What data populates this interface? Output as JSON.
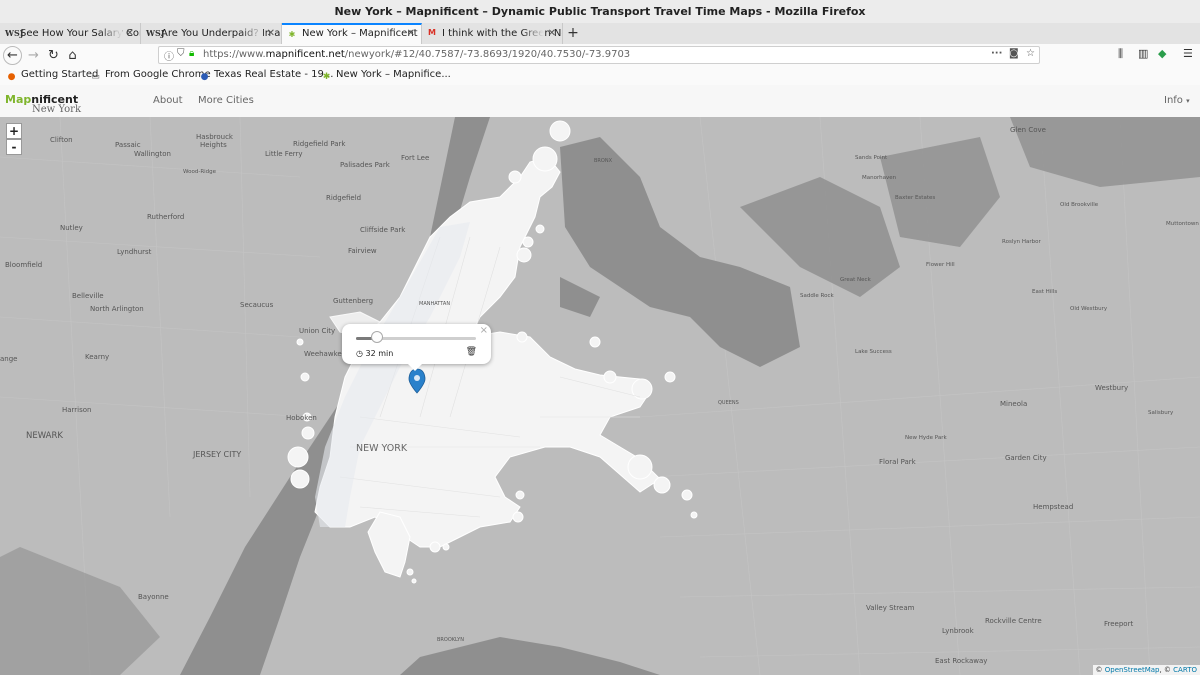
{
  "window": {
    "title": "New York – Mapnificent – Dynamic Public Transport Travel Time Maps - Mozilla Firefox"
  },
  "tabs": [
    {
      "label": "See How Your Salary Com",
      "favicon": "wsj-icon",
      "active": false
    },
    {
      "label": "Are You Underpaid? In a P",
      "favicon": "wsj-icon",
      "active": false
    },
    {
      "label": "New York – Mapnificent",
      "favicon": "mapnificent-icon",
      "active": true
    },
    {
      "label": "I think with the Green Ne",
      "favicon": "gmail-icon",
      "active": false
    }
  ],
  "url": {
    "prefix": "https://www.",
    "domain": "mapnificent.net",
    "path": "/newyork/#12/40.7587/-73.8693/1920/40.7530/-73.9703"
  },
  "bookmarks": [
    {
      "label": "Getting Started",
      "icon": "firefox-icon"
    },
    {
      "label": "From Google Chrome",
      "icon": "folder-icon"
    },
    {
      "label": "Texas Real Estate - 19...",
      "icon": "texas-icon"
    },
    {
      "label": "New York – Mapnifice...",
      "icon": "mapnificent-icon"
    }
  ],
  "app": {
    "brand_green": "Map",
    "brand_rest": "nificent",
    "city": "New York",
    "nav": {
      "about": "About",
      "more_cities": "More Cities",
      "info": "Info"
    }
  },
  "map": {
    "zoom_in": "+",
    "zoom_out": "-",
    "popup": {
      "time_label": "32 min",
      "slider_fraction": 0.17,
      "close": "×"
    },
    "attribution": {
      "osm": "OpenStreetMap",
      "carto": "CARTO"
    },
    "labels": {
      "glen_cove": "Glen Cove",
      "clifton": "Clifton",
      "passaic": "Passaic",
      "wallington": "Wallington",
      "hasbrouck_heights": "Hasbrouck",
      "heights": "Heights",
      "ridgefield_park": "Ridgefield Park",
      "little_ferry": "Little Ferry",
      "palisades_park": "Palisades Park",
      "fort_lee": "Fort Lee",
      "bronx": "BRONX",
      "sands_point": "Sands Point",
      "wood_ridge": "Wood-Ridge",
      "manorhaven": "Manorhaven",
      "baxter_estates": "Baxter Estates",
      "rutherford": "Rutherford",
      "ridgefield": "Ridgefield",
      "cliffside_park": "Cliffside Park",
      "old_brookville": "Old Brookville",
      "muttontown": "Muttontown",
      "nutley": "Nutley",
      "lyndhurst": "Lyndhurst",
      "fairview": "Fairview",
      "roslyn_harbor": "Roslyn Harbor",
      "bloomfield": "Bloomfield",
      "flower_hill": "Flower Hill",
      "great_neck": "Great Neck",
      "saddle_rock": "Saddle Rock",
      "belleville": "Belleville",
      "north_arlington": "North Arlington",
      "secaucus": "Secaucus",
      "guttenberg": "Guttenberg",
      "manhattan": "MANHATTAN",
      "east_hills": "East Hills",
      "old_westbury": "Old Westbury",
      "union_city": "Union City",
      "weehawken": "Weehawken",
      "kearny": "Kearny",
      "lake_success": "Lake Success",
      "westbury": "Westbury",
      "harrison": "Harrison",
      "hoboken": "Hoboken",
      "queens": "QUEENS",
      "mineola": "Mineola",
      "salisbury": "Salisbury",
      "newark": "NEWARK",
      "new_york": "NEW YORK",
      "new_hyde_park": "New Hyde Park",
      "jersey_city": "JERSEY CITY",
      "floral_park": "Floral Park",
      "garden_city": "Garden City",
      "hempstead": "Hempstead",
      "bayonne": "Bayonne",
      "valley_stream": "Valley Stream",
      "rockville_centre": "Rockville Centre",
      "freeport": "Freeport",
      "lynbrook": "Lynbrook",
      "brooklyn": "BROOKLYN",
      "east_rockaway": "East Rockaway",
      "ange": "ange"
    }
  }
}
